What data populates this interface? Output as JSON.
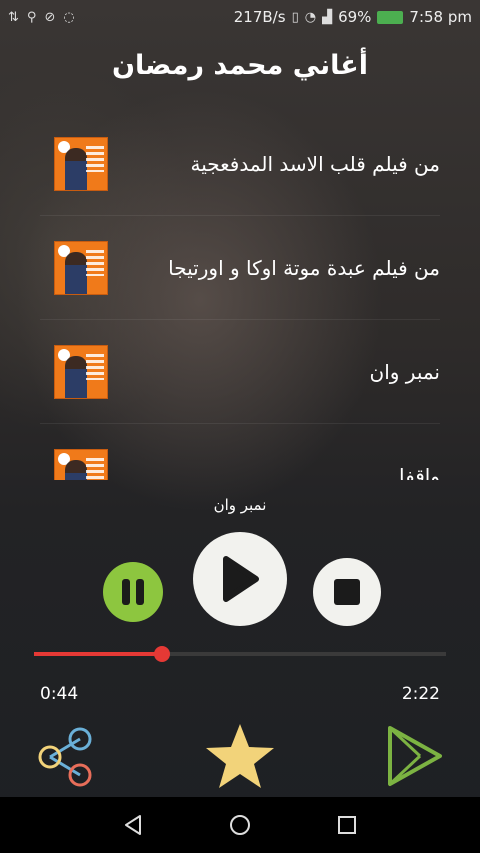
{
  "status_bar": {
    "speed": "217B/s",
    "battery": "69%",
    "time": "7:58 pm"
  },
  "app": {
    "title": "أغاني محمد رمضان"
  },
  "songs": [
    {
      "title": "من فيلم قلب الاسد المدفعجية"
    },
    {
      "title": "من فيلم عبدة موتة اوكا و اورتيجا"
    },
    {
      "title": "نمبر وان"
    },
    {
      "title": "واقفا"
    }
  ],
  "player": {
    "now_playing": "نمبر وان",
    "current_time": "0:44",
    "total_time": "2:22",
    "progress": 0.31
  },
  "colors": {
    "pause_button": "#8dc63f",
    "seek_bar": "#e53935",
    "star": "#f2d37a",
    "playstore": "#7cb342",
    "share": "#6ab0d8"
  },
  "icons": {
    "pause": "pause-icon",
    "play": "play-icon",
    "stop": "stop-icon",
    "share": "share-icon",
    "star": "star-icon",
    "playstore": "playstore-icon"
  }
}
